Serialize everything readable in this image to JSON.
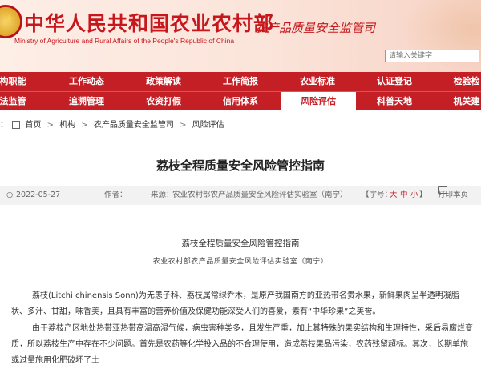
{
  "header": {
    "site_title": "中华人民共和国农业农村部",
    "site_subtitle": "Ministry of Agriculture and Rural Affairs of the People's Republic of China",
    "department": "农产品质量安全监管司",
    "search_placeholder": "请输入关键字"
  },
  "nav": {
    "row1": [
      "构职能",
      "工作动态",
      "政策解读",
      "工作简报",
      "农业标准",
      "认证登记",
      "检验检"
    ],
    "row2": [
      "法监管",
      "追溯管理",
      "农资打假",
      "信用体系",
      "风险评估",
      "科普天地",
      "机关建"
    ],
    "active": "风险评估"
  },
  "breadcrumb": {
    "prefix": "：",
    "items": [
      "首页",
      "机构",
      "农产品质量安全监管司",
      "风险评估"
    ],
    "separator": ">"
  },
  "article": {
    "title": "荔枝全程质量安全风险管控指南",
    "date": "2022-05-27",
    "author_label": "作者：",
    "source_label": "来源：",
    "source": "农业农村部农产品质量安全风险评估实验室（南宁）",
    "font_size_label": "【字号：",
    "font_large": "大",
    "font_medium": "中",
    "font_small": "小",
    "font_close": "】",
    "print_label": "打印本页",
    "doc_title": "荔枝全程质量安全风险管控指南",
    "doc_org": "农业农村部农产品质量安全风险评估实验室（南宁）",
    "paragraph1": "荔枝(Litchi chinensis Sonn)为无患子科、荔枝属常绿乔木，是原产我国南方的亚热带名贵水果，新鲜果肉呈半透明凝脂状、多汁、甘甜，味香美，且具有丰富的营养价值及保健功能深受人们的喜爱，素有“中华珍果”之美誉。",
    "paragraph2": "由于荔枝产区地处热带亚热带高温高湿气候，病虫害种类多，且发生严重，加上其特殊的果实结构和生理特性，采后易腐烂变质，所以荔枝生产中存在不少问题。首先是农药等化学投入品的不合理使用，造成荔枝果品污染，农药残留超标。其次，长期单施或过量施用化肥破坏了土"
  }
}
